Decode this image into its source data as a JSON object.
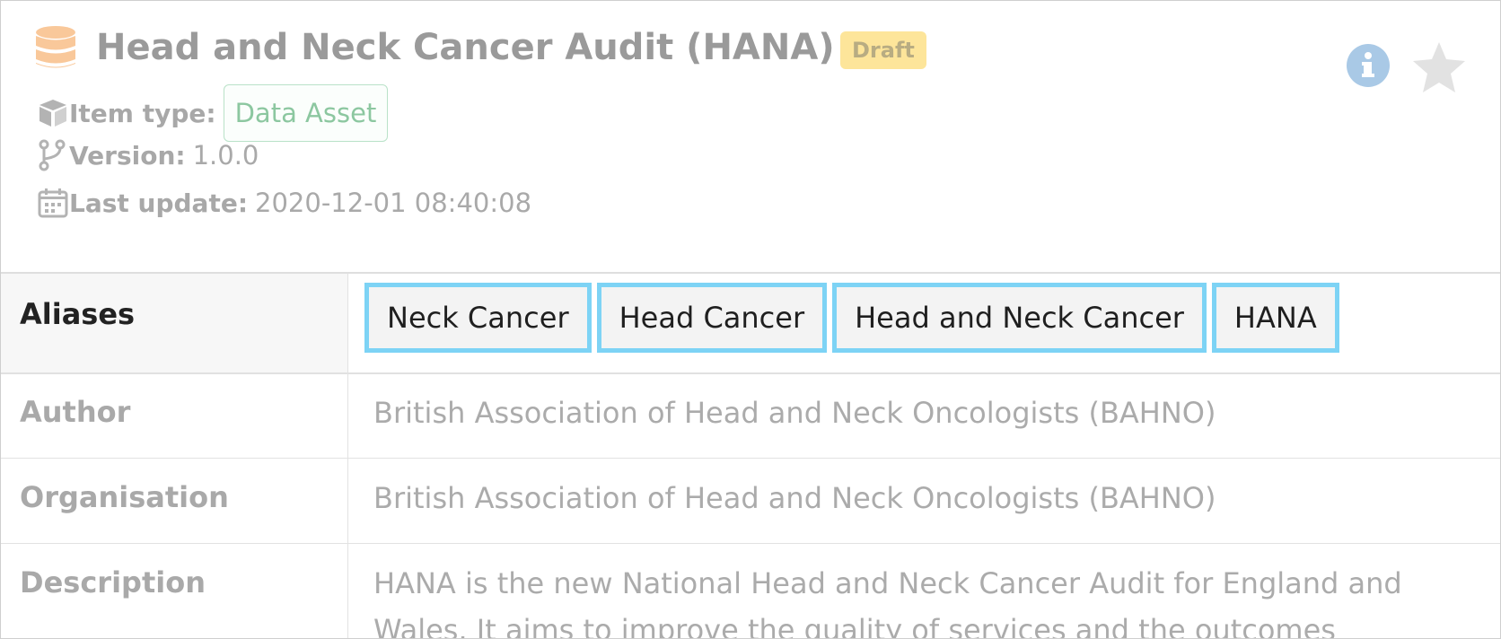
{
  "header": {
    "title": "Head and Neck Cancer Audit (HANA)",
    "status_badge": "Draft",
    "icons": {
      "type": "database-icon",
      "info": "info-icon",
      "favourite": "star-icon"
    }
  },
  "meta": {
    "item_type_label": "Item type:",
    "item_type_value": "Data Asset",
    "version_label": "Version:",
    "version_value": "1.0.0",
    "last_update_label": "Last update:",
    "last_update_value": "2020-12-01 08:40:08"
  },
  "table": {
    "aliases_label": "Aliases",
    "aliases": [
      "Neck Cancer",
      "Head Cancer",
      "Head and Neck Cancer",
      "HANA"
    ],
    "author_label": "Author",
    "author_value": "British Association of Head and Neck Oncologists (BAHNO)",
    "organisation_label": "Organisation",
    "organisation_value": "British Association of Head and Neck Oncologists (BAHNO)",
    "description_label": "Description",
    "description_lines": [
      "HANA is the new National Head and Neck Cancer Audit for England and",
      "Wales. It aims to improve the quality of services and the outcomes"
    ]
  },
  "colors": {
    "accent_chip_border": "#7dd3f5",
    "draft_badge": "#fde59a",
    "type_badge_border": "#b9e2c8",
    "info_icon": "#a9c9e6",
    "database_icon": "#f9c89a"
  }
}
